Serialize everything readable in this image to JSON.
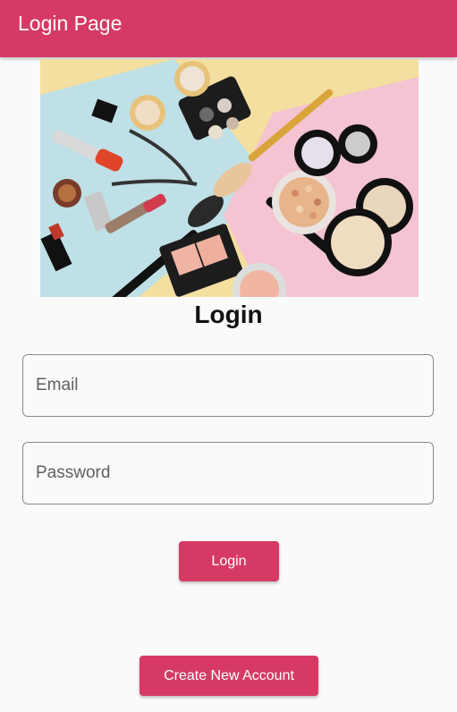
{
  "app_bar": {
    "title": "Login Page"
  },
  "hero": {
    "icon": "makeup-products-image"
  },
  "form": {
    "heading": "Login",
    "email": {
      "placeholder": "Email",
      "value": ""
    },
    "password": {
      "placeholder": "Password",
      "value": ""
    },
    "login_label": "Login",
    "create_account_label": "Create New Account"
  },
  "colors": {
    "accent": "#d63a64",
    "background": "#fafafa",
    "field_border": "#8a8a8a"
  }
}
